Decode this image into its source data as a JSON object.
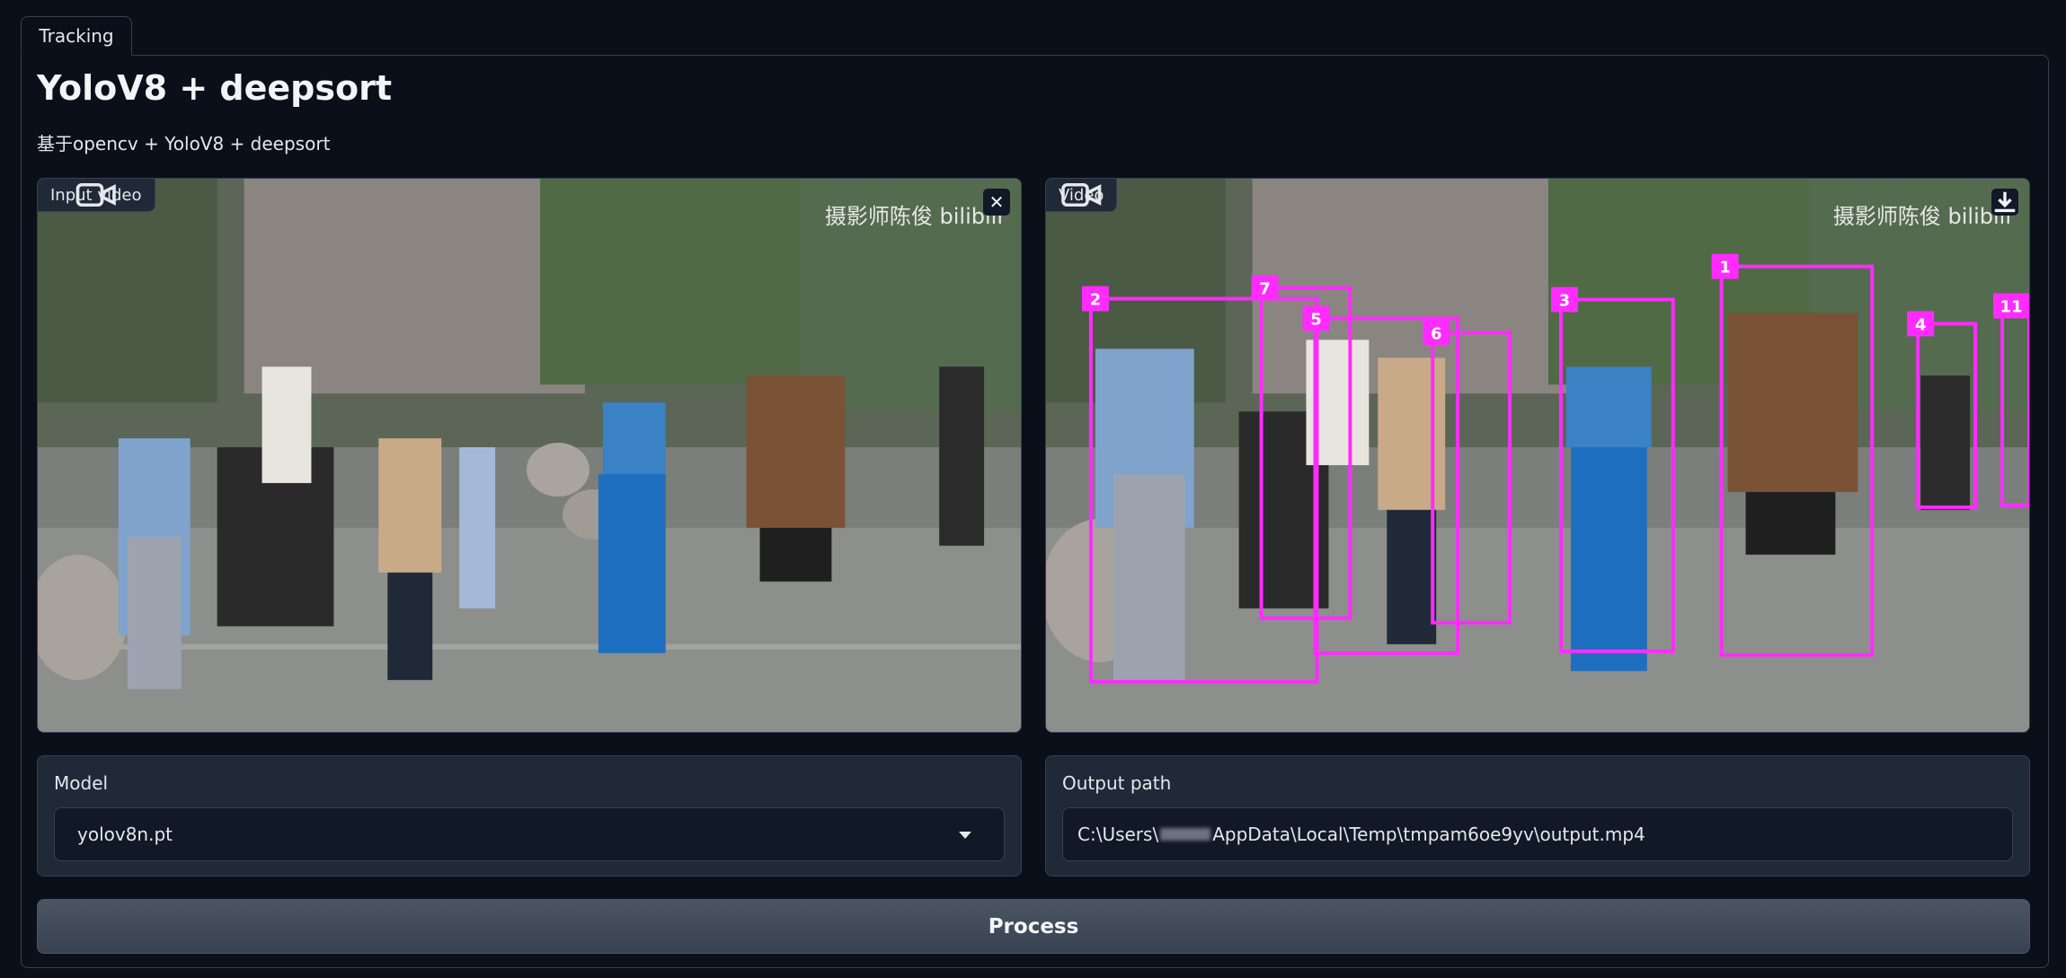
{
  "tab": {
    "label": "Tracking"
  },
  "header": {
    "title": "YoloV8 + deepsort",
    "subtitle": "基于opencv + YoloV8 + deepsort"
  },
  "input_video": {
    "label": "Input video",
    "watermark": "摄影师陈俊 bilibili",
    "close_icon": "close-icon"
  },
  "output_video": {
    "label": "Video",
    "watermark": "摄影师陈俊 bilibili",
    "download_icon": "download-icon",
    "track_ids": [
      "2",
      "7",
      "5",
      "6",
      "3",
      "1",
      "4",
      "11"
    ],
    "box_color": "#ff2bff"
  },
  "model": {
    "label": "Model",
    "value": "yolov8n.pt"
  },
  "output_path": {
    "label": "Output path",
    "prefix": "C:\\Users\\",
    "suffix": "AppData\\Local\\Temp\\tmpam6oe9yv\\output.mp4"
  },
  "process_button": {
    "label": "Process"
  },
  "colors": {
    "background": "#0b0f19",
    "panel": "#1f2937",
    "border": "#374151",
    "box": "#ff2bff"
  }
}
